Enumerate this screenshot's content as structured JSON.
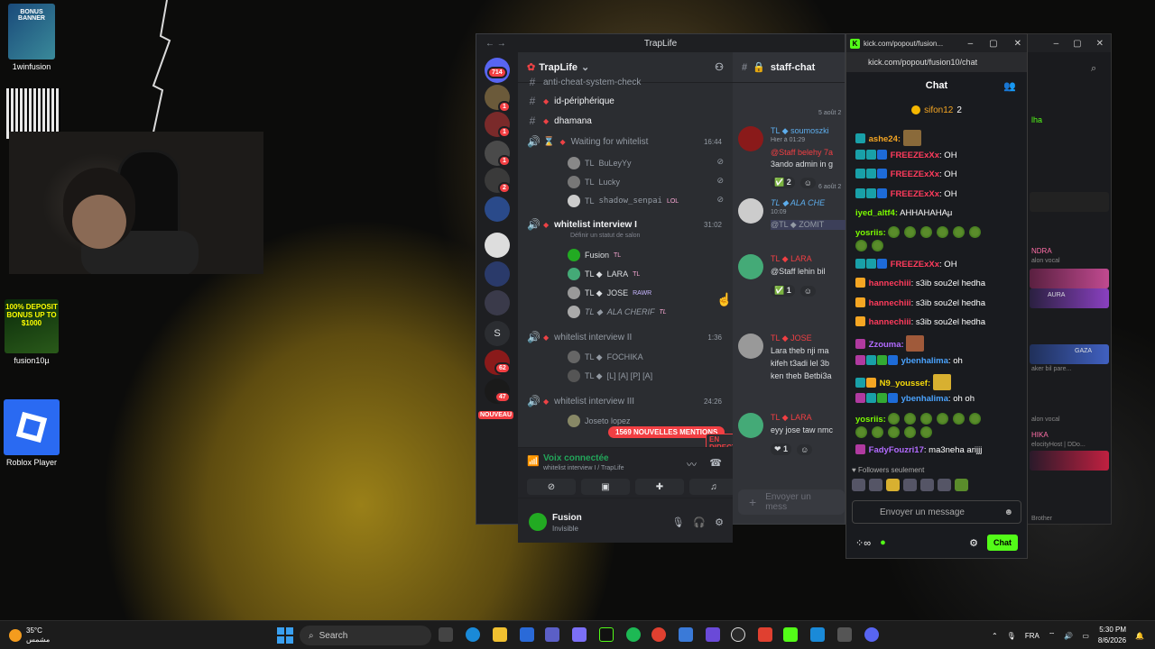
{
  "desktop": {
    "icons": [
      {
        "label": "1winfusion",
        "badge": "BONUS BANNER"
      },
      {
        "label": "fusion10µ",
        "badge": "100% DEPOSIT BONUS UP TO $1000"
      },
      {
        "label": "Roblox Player"
      }
    ]
  },
  "discord": {
    "window_title": "TrapLife",
    "server_name": "TrapLife",
    "guild_badges": [
      "714",
      "1",
      "1",
      "1",
      "2",
      "2",
      "2",
      "62",
      "47"
    ],
    "guild_letter": "S",
    "nouveau": "NOUVEAU",
    "channels": {
      "top_partial": "anti-cheat-system-check",
      "id_peripherique": "id-périphérique",
      "dhamana": "dhamana",
      "waiting": "Waiting for whitelist",
      "waiting_time": "16:44",
      "waiting_members": [
        "BuLeyYy",
        "Lucky",
        "shadow_senpai"
      ],
      "waiting_members_prefix": "TL",
      "lol_tag": "LOL",
      "wl1": "whitelist interview I",
      "wl1_time": "31:02",
      "wl1_status": "Définir un statut de salon",
      "wl1_members": [
        {
          "name": "Fusion",
          "tag": "TL"
        },
        {
          "name": "LARA",
          "tag": "TL"
        },
        {
          "name": "JOSE",
          "tag": "RAWR"
        },
        {
          "name": "ALA CHERIF",
          "tag": "TL"
        }
      ],
      "wl2": "whitelist interview II",
      "wl2_time": "1:36",
      "wl2_members": [
        "FOCHIKA",
        "[L] [A] [P] [A]"
      ],
      "wl3": "whitelist interview III",
      "wl3_time": "24:26",
      "wl3_member": "Joseto lopez"
    },
    "mentions_pill": "1569 NOUVELLES MENTIONS",
    "live_badge": "EN DIRECT",
    "voice": {
      "status": "Voix connectée",
      "location": "whitelist interview I / TrapLife"
    },
    "user": {
      "name": "Fusion",
      "status": "Invisible"
    },
    "message_pane": {
      "channel": "staff-chat",
      "date1": "5 août 2",
      "date2": "6 août 2",
      "messages": [
        {
          "name": "TL ◆ soumoszki",
          "time": "Hier à 01:29",
          "lines": [
            "@Staff belehy 7a",
            "3ando admin in g"
          ],
          "reaction": "2"
        },
        {
          "name": "TL ◆ ALA CHE",
          "time": "10:09",
          "lines": [
            "@TL ◆ ZOMIT"
          ]
        },
        {
          "name": "TL ◆ LARA",
          "lines": [
            "@Staff lehin bil"
          ],
          "reaction": "1"
        },
        {
          "name": "TL ◆ JOSE",
          "lines": [
            "Lara theb nji ma",
            "kifeh t3adi lel 3b",
            "ken theb Betbi3a"
          ]
        },
        {
          "name": "TL ◆ LARA",
          "lines": [
            "eyy jose taw nmc"
          ],
          "reaction": "1"
        }
      ],
      "compose_placeholder": "Envoyer un mess"
    }
  },
  "kick": {
    "window_title": "kick.com/popout/fusion...",
    "url": "kick.com/popout/fusion10/chat",
    "header": "Chat",
    "pinned": {
      "user": "sifon12",
      "count": "2"
    },
    "messages": [
      {
        "user": "ashe24:",
        "color": "#f5a623",
        "text": ""
      },
      {
        "user": "FREEZExXx",
        "color": "#ff3b5c",
        "text": ": OH"
      },
      {
        "user": "FREEZExXx",
        "color": "#ff3b5c",
        "text": ": OH"
      },
      {
        "user": "FREEZExXx",
        "color": "#ff3b5c",
        "text": ": OH"
      },
      {
        "user": "iyed_altf4:",
        "color": "#7cfc00",
        "text": " AHHAHAHAμ"
      },
      {
        "user": "yosriis:",
        "color": "#7cfc00",
        "text": ""
      },
      {
        "user": "FREEZExXx",
        "color": "#ff3b5c",
        "text": ": OH"
      },
      {
        "user": "hannechiii",
        "color": "#ff3b5c",
        "text": ": s3ib sou2el hedha"
      },
      {
        "user": "hannechiii",
        "color": "#ff3b5c",
        "text": ": s3ib sou2el hedha"
      },
      {
        "user": "hannechiii",
        "color": "#ff3b5c",
        "text": ": s3ib sou2el hedha"
      },
      {
        "user": "Zzouma:",
        "color": "#b26bff",
        "text": ""
      },
      {
        "user": "ybenhalima",
        "color": "#4aa3ff",
        "text": ": oh"
      },
      {
        "user": "N9_youssef:",
        "color": "#f5d90a",
        "text": ""
      },
      {
        "user": "ybenhalima",
        "color": "#4aa3ff",
        "text": ": oh oh"
      },
      {
        "user": "yosriis:",
        "color": "#7cfc00",
        "text": ""
      },
      {
        "user": "FadyFouzri17",
        "color": "#b26bff",
        "text": ": ma3neha arijjj"
      }
    ],
    "followers_only": "Followers seulement",
    "input_placeholder": "Envoyer un message",
    "chat_button": "Chat"
  },
  "kick_back": {
    "labels": [
      "lha",
      "NDRA",
      "alon vocal",
      "AURA",
      "Pride",
      "GAZA",
      "aker bil pare...",
      "alon vocal",
      "HIKA",
      "elocityHost | DDo...",
      "alon vocal",
      "Brother"
    ]
  },
  "taskbar": {
    "temp": "35°C",
    "weather_sub": "مشمس",
    "search": "Search",
    "lang": "FRA",
    "time": "5:30 PM",
    "date": "8/6/2026"
  }
}
